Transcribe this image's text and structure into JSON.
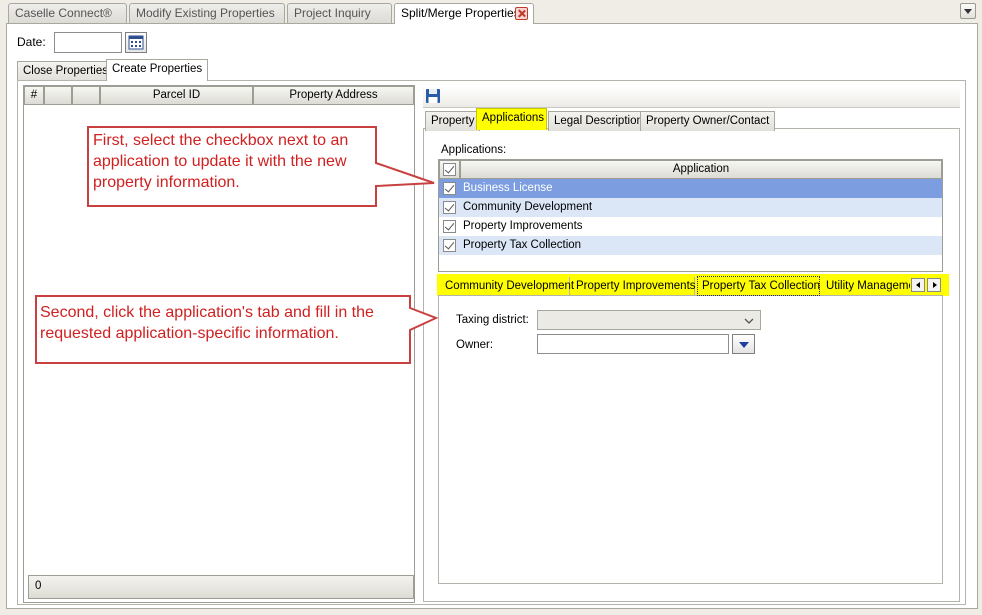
{
  "doc_tabs": [
    {
      "label": "Caselle Connect®"
    },
    {
      "label": "Modify Existing Properties"
    },
    {
      "label": "Project Inquiry"
    },
    {
      "label": "Split/Merge Properties"
    }
  ],
  "date": {
    "label": "Date:",
    "value": ""
  },
  "sub_tabs": [
    {
      "label": "Close Properties"
    },
    {
      "label": "Create Properties"
    }
  ],
  "grid": {
    "columns": [
      "#",
      "",
      "",
      "Parcel ID",
      "Property Address"
    ],
    "footer_count": "0"
  },
  "detail_tabs": [
    {
      "label": "Property"
    },
    {
      "label": "Applications"
    },
    {
      "label": "Legal Description"
    },
    {
      "label": "Property Owner/Contact"
    }
  ],
  "applications": {
    "label": "Applications:",
    "column": "Application",
    "rows": [
      {
        "label": "Business License",
        "checked": true
      },
      {
        "label": "Community Development",
        "checked": true
      },
      {
        "label": "Property Improvements",
        "checked": true
      },
      {
        "label": "Property Tax Collection",
        "checked": true
      }
    ]
  },
  "app_tabs": [
    {
      "label": "Community Development"
    },
    {
      "label": "Property Improvements"
    },
    {
      "label": "Property Tax Collection"
    },
    {
      "label": "Utility Managemen"
    }
  ],
  "form": {
    "taxing_district_label": "Taxing district:",
    "taxing_district_value": "",
    "owner_label": "Owner:",
    "owner_value": ""
  },
  "callouts": {
    "first": "First, select the checkbox next to an application to update it with the new property information.",
    "second": "Second, click the application's tab and fill in the requested application-specific information."
  },
  "colors": {
    "highlight": "#ffff00",
    "selected_row": "#7c9ee0",
    "alt_row": "#dbe6f7",
    "callout": "#d02020"
  }
}
